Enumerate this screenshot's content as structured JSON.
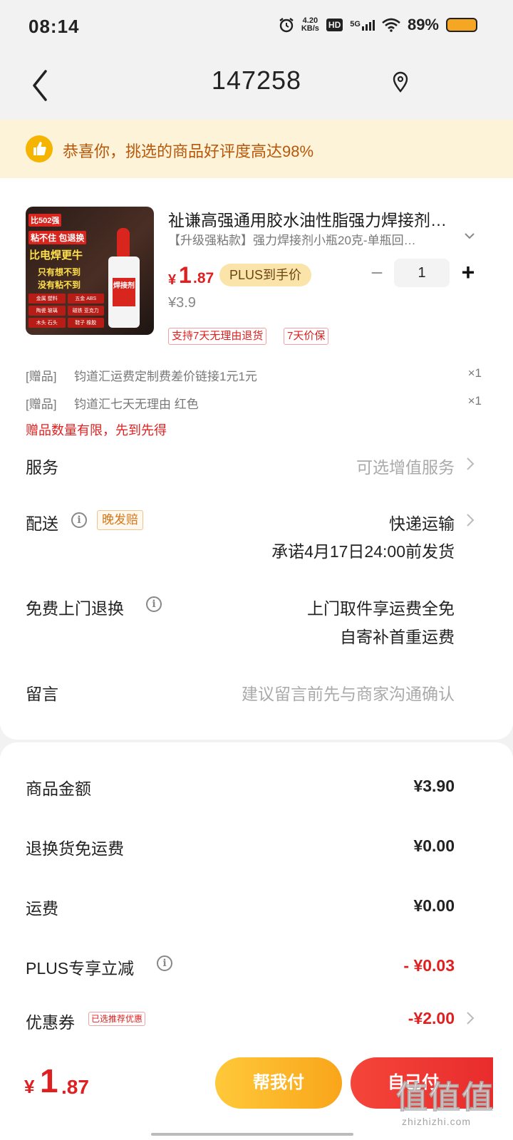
{
  "status_bar": {
    "time": "08:14",
    "net_speed_value": "4.20",
    "net_speed_unit": "KB/s",
    "hd": "HD",
    "signal": "5G",
    "battery": "89%"
  },
  "nav": {
    "title": "147258",
    "back_icon": "chevron-left-icon",
    "location_icon": "location-pin-icon"
  },
  "banner": {
    "icon": "thumbs-up-icon",
    "text": "恭喜你，挑选的商品好评度高达98%"
  },
  "product": {
    "image_text": {
      "top": "比502强",
      "line1": "粘不住 包退换",
      "line2": "比电焊更牛",
      "line3": "只有想不到",
      "line4": "没有粘不到",
      "bottle_label": "焊接剂",
      "grid": [
        "金属 塑料",
        "五金 ABS",
        "陶瓷 玻璃",
        "磁铁 亚克力",
        "木头 石头",
        "鞋子 橡胶"
      ]
    },
    "title": "祉谦高强通用胶水油性脂强力焊接剂…",
    "spec": "【升级强粘款】强力焊接剂小瓶20克-单瓶回…",
    "price_currency": "¥",
    "price_int": "1",
    "price_dec": ".87",
    "plus_label": "PLUS到手价",
    "original_price": "¥3.9",
    "quantity": "1",
    "minus_label": "−",
    "plus_qty_label": "+",
    "tags": [
      "支持7天无理由退货",
      "7天价保"
    ]
  },
  "gifts": [
    {
      "label": "[赠品]",
      "text": "钧道汇运费定制费差价链接1元1元",
      "qty": "×1"
    },
    {
      "label": "[赠品]",
      "text": "钧道汇七天无理由 红色",
      "qty": "×1"
    }
  ],
  "gift_note": "赠品数量有限，先到先得",
  "rows": {
    "service_label": "服务",
    "service_value": "可选增值服务",
    "delivery_label": "配送",
    "delivery_badge": "晚发赔",
    "delivery_value": "快递运输",
    "delivery_promise": "承诺4月17日24:00前发货",
    "return_label": "免费上门退换",
    "return_value1": "上门取件享运费全免",
    "return_value2": "自寄补首重运费",
    "message_label": "留言",
    "message_placeholder": "建议留言前先与商家沟通确认"
  },
  "summary": {
    "goods_label": "商品金额",
    "goods_value": "¥3.90",
    "return_ship_label": "退换货免运费",
    "return_ship_value": "¥0.00",
    "shipping_label": "运费",
    "shipping_value": "¥0.00",
    "plus_label": "PLUS专享立减",
    "plus_value": "- ¥0.03",
    "coupon_label": "优惠券",
    "coupon_hint": "已选推荐优惠",
    "coupon_value": "-¥2.00"
  },
  "bottom": {
    "total_currency": "¥",
    "total_int": "1",
    "total_dec": ".87",
    "help_pay": "帮我付",
    "self_pay": "自己付"
  },
  "watermark": {
    "big": "值值值",
    "small": "zhizhizhi.com"
  },
  "colors": {
    "accent_red": "#e02020",
    "banner_bg": "#fdf3d9",
    "help_button": "#f9a51a",
    "pay_button": "#e82c2c"
  }
}
